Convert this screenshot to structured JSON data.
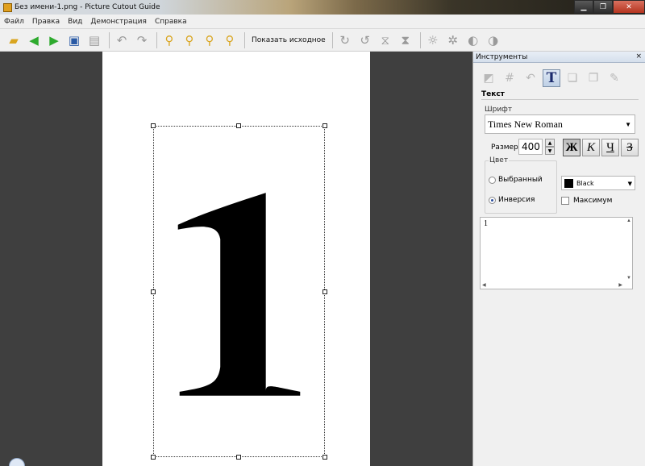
{
  "window": {
    "title": "Без имени-1.png - Picture Cutout Guide",
    "min_glyph": "▁",
    "restore_glyph": "❐",
    "close_glyph": "✕"
  },
  "menu": [
    "Файл",
    "Правка",
    "Вид",
    "Демонстрация",
    "Справка"
  ],
  "toolbar": {
    "show_original_label": "Показать исходное"
  },
  "canvas": {
    "digit": "1"
  },
  "panel": {
    "title": "Инструменты",
    "close_glyph": "×",
    "section_title": "Текст",
    "font_group_label": "Шрифт",
    "font_value": "Times New Roman",
    "size_label": "Размер:",
    "size_value": "400",
    "style_buttons": [
      "Ж",
      "К",
      "Ч",
      "З"
    ],
    "color_group_label": "Цвет",
    "radio_selected_label": "Выбранный",
    "radio_inverse_label": "Инверсия",
    "radio_checked": "inverse",
    "color_value": "Black",
    "color_hex": "#000000",
    "maximum_label": "Максимум",
    "text_content": "1"
  }
}
